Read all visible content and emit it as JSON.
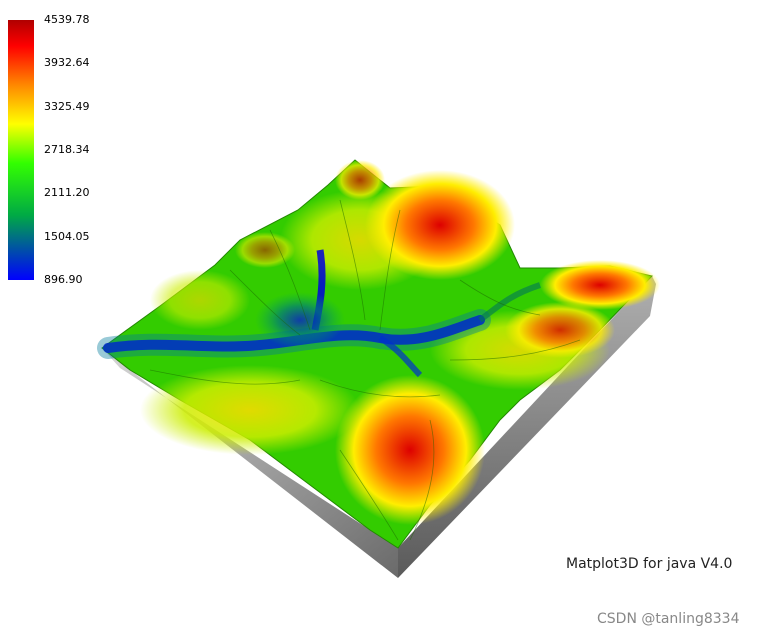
{
  "chart_data": {
    "type": "heatmap",
    "colorbar": {
      "min": 896.9,
      "max": 4539.78,
      "ticks": [
        "4539.78",
        "3932.64",
        "3325.49",
        "2718.34",
        "2111.20",
        "1504.05",
        "896.90"
      ],
      "colors": [
        "#0000ff",
        "#00ff00",
        "#ffff00",
        "#ff0000",
        "#c00000"
      ]
    },
    "title": "",
    "xlabel": "",
    "ylabel": "",
    "grid": false
  },
  "footer": {
    "app_label": "Matplot3D for java V4.0",
    "watermark": "CSDN @tanling8334"
  }
}
